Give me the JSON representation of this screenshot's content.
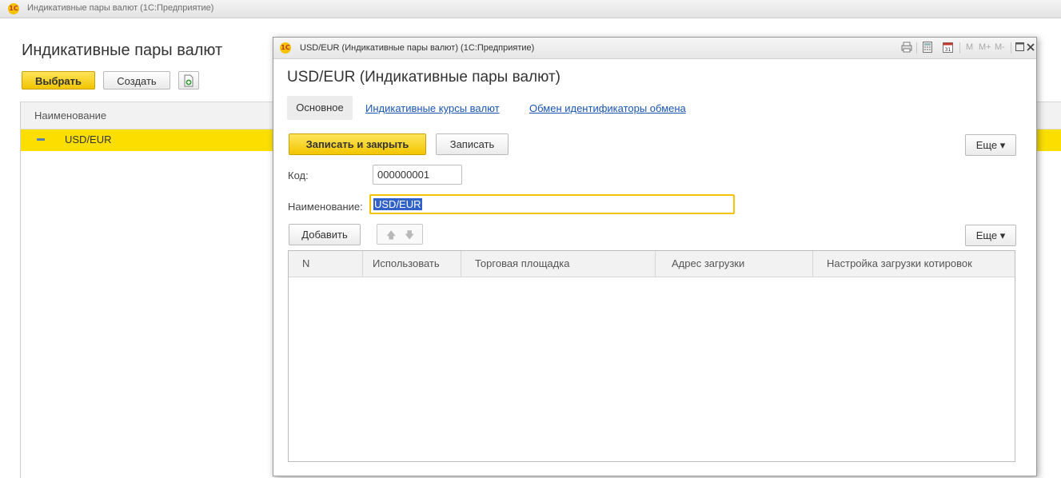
{
  "main": {
    "window_title": "Индикативные пары валют  (1С:Предприятие)",
    "heading": "Индикативные пары валют",
    "buttons": {
      "select": "Выбрать",
      "create": "Создать"
    },
    "column_header": "Наименование",
    "rows": [
      {
        "name": "USD/EUR",
        "selected": true
      }
    ]
  },
  "dialog": {
    "window_title": "USD/EUR (Индикативные пары валют)  (1С:Предприятие)",
    "toolbar_text": {
      "m": "M",
      "mplus": "M+",
      "mminus": "M-"
    },
    "heading": "USD/EUR (Индикативные пары валют)",
    "tabs": [
      {
        "label": "Основное",
        "active": true
      },
      {
        "label": "Индикативные курсы валют",
        "active": false
      },
      {
        "label": "Обмен идентификаторы обмена",
        "active": false
      }
    ],
    "buttons": {
      "save_close": "Записать и закрыть",
      "save": "Записать",
      "more": "Еще ▾",
      "add": "Добавить",
      "more2": "Еще ▾"
    },
    "fields": {
      "code_label": "Код:",
      "code_value": "000000001",
      "name_label": "Наименование:",
      "name_value": "USD/EUR"
    },
    "table": {
      "columns": [
        "N",
        "Использовать",
        "Торговая площадка",
        "Адрес загрузки",
        "Настройка загрузки котировок"
      ],
      "rows": []
    }
  },
  "colors": {
    "accent_yellow": "#f2c500",
    "selected_row": "#fcdf00",
    "link": "#1a56b4",
    "selection": "#3162c8"
  }
}
